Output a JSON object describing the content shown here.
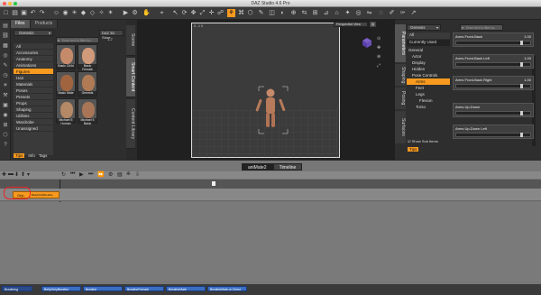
{
  "app": {
    "title": "DAZ Studio 4.6 Pro"
  },
  "left_tabs": {
    "files": "Files",
    "products": "Products"
  },
  "content": {
    "folder": "Genesis",
    "store": "DAZ 3D Store",
    "search": "Enter text to filter by...",
    "page": "1-7"
  },
  "categories": [
    "All",
    "Accessories",
    "Anatomy",
    "Animations",
    "Figures",
    "Hair",
    "Materials",
    "Poses",
    "Presets",
    "Props",
    "Shaping",
    "Utilities",
    "Wardrobe",
    "Unassigned"
  ],
  "thumbs": [
    {
      "label": "Basic Child",
      "color": "#c48a6a"
    },
    {
      "label": "Basic Female",
      "color": "#d19a7a"
    },
    {
      "label": "Basic Male",
      "color": "#a0653f"
    },
    {
      "label": "Genesis",
      "color": "#b07a55"
    },
    {
      "label": "Michael 5 Human",
      "color": "#b58866"
    },
    {
      "label": "Michael 5 Basic",
      "color": "#a87656"
    }
  ],
  "content_bottom": {
    "tips": "Tips",
    "info": "Info",
    "tags": "Tags"
  },
  "side_vtabs": {
    "scene": "Scene",
    "smart": "Smart Content",
    "library": "Content Library"
  },
  "viewport": {
    "camera": "Perspective View",
    "readout": "0 - 1 0"
  },
  "right": {
    "folder": "Genesis",
    "search": "Enter text to filter by...",
    "all": "All",
    "currently_used": "Currently Used",
    "tree": [
      "General",
      "Actor",
      "Display",
      "Hidden",
      "Pose Controls",
      "Arms",
      "Feet",
      "Legs",
      "Flexion",
      "Torso"
    ],
    "show_sub": "Show Sub Items",
    "tips": "Tips",
    "vtabs": [
      "Parameters",
      "Shaping",
      "Posing",
      "Surfaces"
    ],
    "props": [
      {
        "label": "Arms Front-Back",
        "value": "1.00"
      },
      {
        "label": "Arms Front-Back Left",
        "value": "1.00"
      },
      {
        "label": "Arms Front-Back Right",
        "value": "1.00"
      },
      {
        "label": "Arms Up-Down",
        "value": ""
      },
      {
        "label": "Arms Up-Down Left",
        "value": ""
      }
    ]
  },
  "bottom": {
    "tab1": "aniMate2",
    "tab2": "Timeline",
    "track_label": "Grip",
    "track_sub": "BellyDollyBreathe"
  },
  "clips": {
    "label": "Breathing",
    "items": [
      "BellyOnlyBreathe",
      "Breathe",
      "BreatheFemale",
      "BreatheMale",
      "BreatheMale-w-Chest"
    ]
  },
  "colors": {
    "accent": "#f89a1f",
    "clip": "#3a6ec2",
    "highlight": "#e8262a"
  }
}
